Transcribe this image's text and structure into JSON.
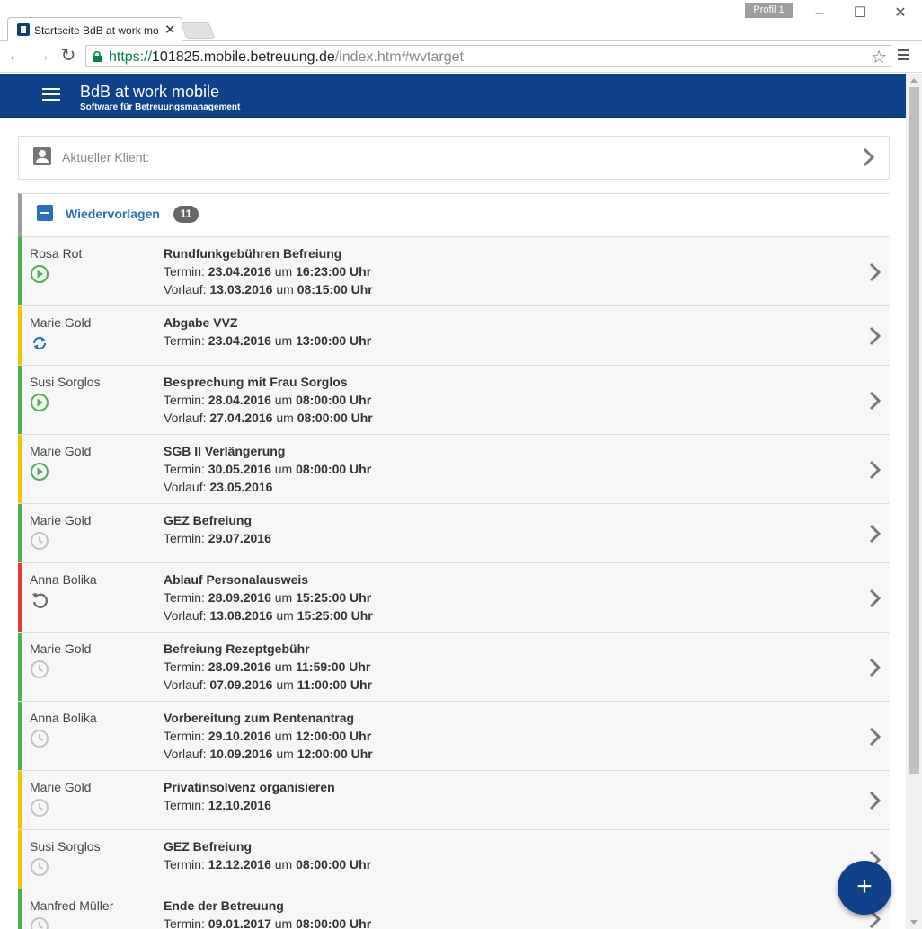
{
  "browser": {
    "profile": "Profil 1",
    "tab_title": "Startseite BdB at work mo",
    "url_scheme": "https://",
    "url_host": "101825.mobile.betreuung.de",
    "url_path": "/index.htm#wvtarget"
  },
  "app": {
    "title": "BdB at work mobile",
    "subtitle": "Software für Betreuungsmanagement",
    "brand_color": "#0d428a"
  },
  "klient": {
    "label": "Aktueller Klient:"
  },
  "list": {
    "title": "Wiedervorlagen",
    "count": "11",
    "rows": [
      {
        "name": "Rosa Rot",
        "status": "green",
        "icon": "play-circle-icon",
        "title": "Rundfunkgebühren Befreiung",
        "termin": {
          "label": "Termin:",
          "date": "23.04.2016",
          "um": "um",
          "time": "16:23:00 Uhr"
        },
        "vorlauf": {
          "label": "Vorlauf:",
          "date": "13.03.2016",
          "um": "um",
          "time": "08:15:00 Uhr"
        }
      },
      {
        "name": "Marie Gold",
        "status": "yellow",
        "icon": "sync-icon",
        "title": "Abgabe VVZ",
        "termin": {
          "label": "Termin:",
          "date": "23.04.2016",
          "um": "um",
          "time": "13:00:00 Uhr"
        }
      },
      {
        "name": "Susi Sorglos",
        "status": "green",
        "icon": "play-circle-icon",
        "title": "Besprechung mit Frau Sorglos",
        "termin": {
          "label": "Termin:",
          "date": "28.04.2016",
          "um": "um",
          "time": "08:00:00 Uhr"
        },
        "vorlauf": {
          "label": "Vorlauf:",
          "date": "27.04.2016",
          "um": "um",
          "time": "08:00:00 Uhr"
        }
      },
      {
        "name": "Marie Gold",
        "status": "yellow",
        "icon": "play-circle-icon",
        "title": "SGB II Verlängerung",
        "termin": {
          "label": "Termin:",
          "date": "30.05.2016",
          "um": "um",
          "time": "08:00:00 Uhr"
        },
        "vorlauf": {
          "label": "Vorlauf:",
          "date": "23.05.2016"
        }
      },
      {
        "name": "Marie Gold",
        "status": "green",
        "icon": "clock-icon",
        "title": "GEZ Befreiung",
        "termin": {
          "label": "Termin:",
          "date": "29.07.2016"
        }
      },
      {
        "name": "Anna Bolika",
        "status": "red",
        "icon": "undo-icon",
        "title": "Ablauf Personalausweis",
        "termin": {
          "label": "Termin:",
          "date": "28.09.2016",
          "um": "um",
          "time": "15:25:00 Uhr"
        },
        "vorlauf": {
          "label": "Vorlauf:",
          "date": "13.08.2016",
          "um": "um",
          "time": "15:25:00 Uhr"
        }
      },
      {
        "name": "Marie Gold",
        "status": "green",
        "icon": "clock-icon",
        "title": "Befreiung Rezeptgebühr",
        "termin": {
          "label": "Termin:",
          "date": "28.09.2016",
          "um": "um",
          "time": "11:59:00 Uhr"
        },
        "vorlauf": {
          "label": "Vorlauf:",
          "date": "07.09.2016",
          "um": "um",
          "time": "11:00:00 Uhr"
        }
      },
      {
        "name": "Anna Bolika",
        "status": "green",
        "icon": "clock-icon",
        "title": "Vorbereitung zum Rentenantrag",
        "termin": {
          "label": "Termin:",
          "date": "29.10.2016",
          "um": "um",
          "time": "12:00:00 Uhr"
        },
        "vorlauf": {
          "label": "Vorlauf:",
          "date": "10.09.2016",
          "um": "um",
          "time": "12:00:00 Uhr"
        }
      },
      {
        "name": "Marie Gold",
        "status": "yellow",
        "icon": "clock-icon",
        "title": "Privatinsolvenz organisieren",
        "termin": {
          "label": "Termin:",
          "date": "12.10.2016"
        }
      },
      {
        "name": "Susi Sorglos",
        "status": "yellow",
        "icon": "clock-icon",
        "title": "GEZ Befreiung",
        "termin": {
          "label": "Termin:",
          "date": "12.12.2016",
          "um": "um",
          "time": "08:00:00 Uhr"
        }
      },
      {
        "name": "Manfred Müller",
        "status": "green",
        "icon": "clock-icon",
        "title": "Ende der Betreuung",
        "termin": {
          "label": "Termin:",
          "date": "09.01.2017",
          "um": "um",
          "time": "08:00:00 Uhr"
        }
      }
    ]
  },
  "colors": {
    "green": "#4caf50",
    "yellow": "#f5c400",
    "red": "#e53935",
    "link_blue": "#2a6fbe"
  },
  "fab": {
    "label": "+"
  }
}
